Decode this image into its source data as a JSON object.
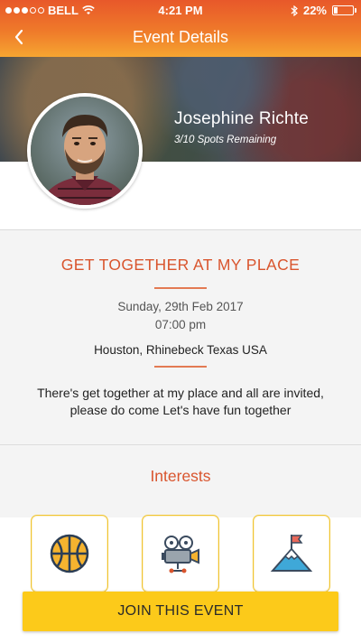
{
  "status_bar": {
    "carrier": "BELL",
    "time": "4:21 PM",
    "battery_percent": "22%",
    "battery_level": 0.22,
    "signal_dots_filled": 3,
    "signal_dots_total": 5
  },
  "nav": {
    "title": "Event Details",
    "back_icon": "chevron-left-icon"
  },
  "host": {
    "name": "Josephine Richte",
    "spots": "3/10 Spots Remaining"
  },
  "event": {
    "title": "GET TOGETHER AT MY PLACE",
    "date": "Sunday, 29th Feb 2017",
    "time": "07:00 pm",
    "location": "Houston, Rhinebeck Texas USA",
    "description": "There's get together at my place and all are invited, please do come Let's have fun together"
  },
  "interests": {
    "title": "Interests",
    "items": [
      {
        "icon": "basketball-icon"
      },
      {
        "icon": "film-camera-icon"
      },
      {
        "icon": "mountain-flag-icon"
      }
    ]
  },
  "actions": {
    "join_label": "JOIN THIS EVENT"
  },
  "colors": {
    "header_gradient_top": "#e8582a",
    "header_gradient_bottom": "#f6a531",
    "accent_orange": "#d9552e",
    "join_button": "#fcca1a",
    "tile_border": "#f0c430"
  }
}
